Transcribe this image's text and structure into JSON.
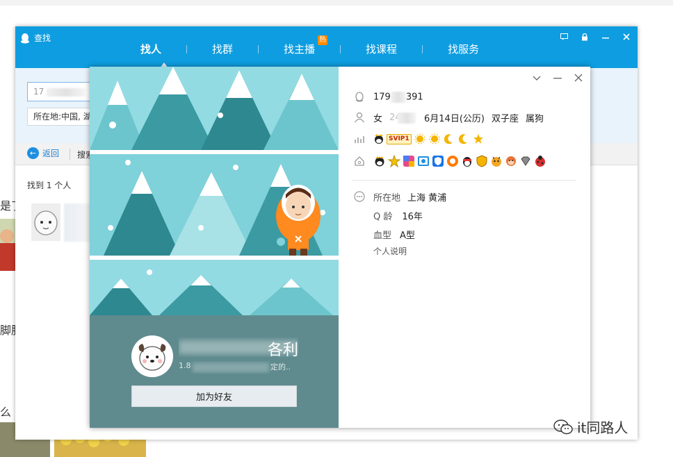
{
  "window": {
    "title": "查找",
    "tabs": [
      {
        "label": "找人",
        "active": true
      },
      {
        "label": "找群"
      },
      {
        "label": "找主播",
        "badge": "热"
      },
      {
        "label": "找课程"
      },
      {
        "label": "找服务"
      }
    ]
  },
  "search": {
    "query": "17",
    "location": "所在地:中国, 湖"
  },
  "toolbar": {
    "back_label": "返回",
    "search_label": "搜索"
  },
  "results": {
    "found_text": "找到 1 个人"
  },
  "background": {
    "snippets": [
      "是了",
      "脚肺",
      "么"
    ]
  },
  "profile": {
    "qq_number": "179",
    "qq_number_tail": "391",
    "gender": "女",
    "age": "24",
    "birthday": "6月14日(公历)",
    "constellation": "双子座",
    "zodiac": "属狗",
    "vip_badge": "SVIP1",
    "nickname_tail": "各利",
    "signature_head": "1.8",
    "signature_tail": "定的..",
    "add_friend_label": "加为好友",
    "location_label": "所在地",
    "location_value": "上海 黄浦",
    "qage_label": "Q 龄",
    "qage_value": "16年",
    "blood_label": "血型",
    "blood_value": "A型",
    "bio_label": "个人说明"
  },
  "watermark": "it同路人",
  "colors": {
    "header_blue": "#0e9de0",
    "card_left": "#5f8b8f",
    "scene_sky": "#93dbe2",
    "scene_band": "#7fd1da",
    "tree_dark": "#3b9aa2",
    "tree_light": "#6cc5cc"
  }
}
